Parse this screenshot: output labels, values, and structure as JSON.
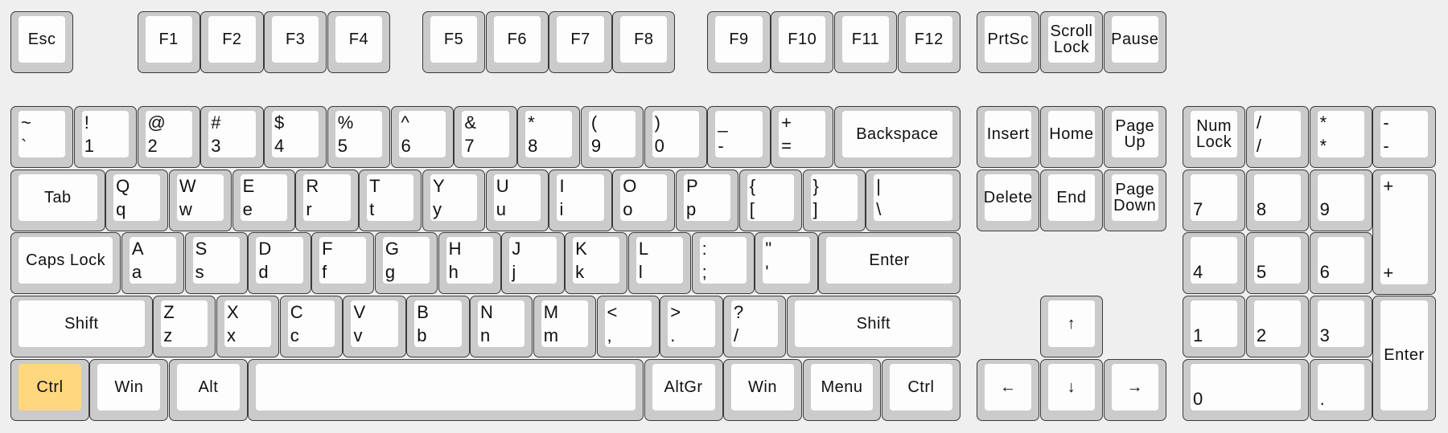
{
  "highlight_color": "#ffd77f",
  "keyboard": {
    "function_row": [
      {
        "label": "Esc"
      },
      {
        "label": "F1"
      },
      {
        "label": "F2"
      },
      {
        "label": "F3"
      },
      {
        "label": "F4"
      },
      {
        "label": "F5"
      },
      {
        "label": "F6"
      },
      {
        "label": "F7"
      },
      {
        "label": "F8"
      },
      {
        "label": "F9"
      },
      {
        "label": "F10"
      },
      {
        "label": "F11"
      },
      {
        "label": "F12"
      },
      {
        "label": "PrtSc"
      },
      {
        "label": "Scroll\nLock"
      },
      {
        "label": "Pause"
      }
    ],
    "number_row": [
      {
        "top": "~",
        "bottom": "`"
      },
      {
        "top": "!",
        "bottom": "1"
      },
      {
        "top": "@",
        "bottom": "2"
      },
      {
        "top": "#",
        "bottom": "3"
      },
      {
        "top": "$",
        "bottom": "4"
      },
      {
        "top": "%",
        "bottom": "5"
      },
      {
        "top": "^",
        "bottom": "6"
      },
      {
        "top": "&",
        "bottom": "7"
      },
      {
        "top": "*",
        "bottom": "8"
      },
      {
        "top": "(",
        "bottom": "9"
      },
      {
        "top": ")",
        "bottom": "0"
      },
      {
        "top": "_",
        "bottom": "-"
      },
      {
        "top": "+",
        "bottom": "="
      },
      {
        "label": "Backspace"
      }
    ],
    "q_row": [
      {
        "label": "Tab"
      },
      {
        "top": "Q",
        "bottom": "q"
      },
      {
        "top": "W",
        "bottom": "w"
      },
      {
        "top": "E",
        "bottom": "e"
      },
      {
        "top": "R",
        "bottom": "r"
      },
      {
        "top": "T",
        "bottom": "t"
      },
      {
        "top": "Y",
        "bottom": "y"
      },
      {
        "top": "U",
        "bottom": "u"
      },
      {
        "top": "I",
        "bottom": "i"
      },
      {
        "top": "O",
        "bottom": "o"
      },
      {
        "top": "P",
        "bottom": "p"
      },
      {
        "top": "{",
        "bottom": "["
      },
      {
        "top": "}",
        "bottom": "]"
      },
      {
        "top": "|",
        "bottom": "\\"
      }
    ],
    "a_row": [
      {
        "label": "Caps Lock"
      },
      {
        "top": "A",
        "bottom": "a"
      },
      {
        "top": "S",
        "bottom": "s"
      },
      {
        "top": "D",
        "bottom": "d"
      },
      {
        "top": "F",
        "bottom": "f"
      },
      {
        "top": "G",
        "bottom": "g"
      },
      {
        "top": "H",
        "bottom": "h"
      },
      {
        "top": "J",
        "bottom": "j"
      },
      {
        "top": "K",
        "bottom": "k"
      },
      {
        "top": "L",
        "bottom": "l"
      },
      {
        "top": ":",
        "bottom": ";"
      },
      {
        "top": "\"",
        "bottom": "'"
      },
      {
        "label": "Enter"
      }
    ],
    "z_row": [
      {
        "label": "Shift"
      },
      {
        "top": "Z",
        "bottom": "z"
      },
      {
        "top": "X",
        "bottom": "x"
      },
      {
        "top": "C",
        "bottom": "c"
      },
      {
        "top": "V",
        "bottom": "v"
      },
      {
        "top": "B",
        "bottom": "b"
      },
      {
        "top": "N",
        "bottom": "n"
      },
      {
        "top": "M",
        "bottom": "m"
      },
      {
        "top": "<",
        "bottom": ","
      },
      {
        "top": ">",
        "bottom": "."
      },
      {
        "top": "?",
        "bottom": "/"
      },
      {
        "label": "Shift"
      }
    ],
    "bottom_row": [
      {
        "label": "Ctrl",
        "highlighted": true
      },
      {
        "label": "Win"
      },
      {
        "label": "Alt"
      },
      {
        "label": ""
      },
      {
        "label": "AltGr"
      },
      {
        "label": "Win"
      },
      {
        "label": "Menu"
      },
      {
        "label": "Ctrl"
      }
    ],
    "navigation": [
      {
        "label": "Insert"
      },
      {
        "label": "Home"
      },
      {
        "label": "Page\nUp"
      },
      {
        "label": "Delete"
      },
      {
        "label": "End"
      },
      {
        "label": "Page\nDown"
      },
      {
        "label": "↑"
      },
      {
        "label": "←"
      },
      {
        "label": "↓"
      },
      {
        "label": "→"
      }
    ],
    "numpad": [
      {
        "label": "Num\nLock"
      },
      {
        "top": "/",
        "bottom": "/"
      },
      {
        "top": "*",
        "bottom": "*"
      },
      {
        "top": "-",
        "bottom": "-"
      },
      {
        "bottom": "7"
      },
      {
        "bottom": "8"
      },
      {
        "bottom": "9"
      },
      {
        "top": "+",
        "bottom": "+"
      },
      {
        "bottom": "4"
      },
      {
        "bottom": "5"
      },
      {
        "bottom": "6"
      },
      {
        "bottom": "1"
      },
      {
        "bottom": "2"
      },
      {
        "bottom": "3"
      },
      {
        "label": "Enter"
      },
      {
        "bottom": "0"
      },
      {
        "bottom": "."
      }
    ]
  }
}
